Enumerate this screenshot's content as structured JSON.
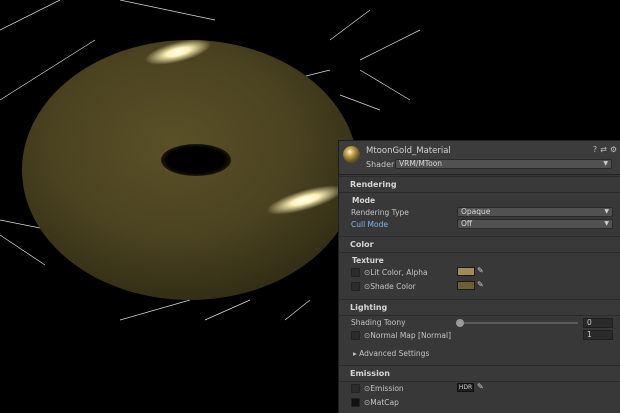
{
  "material": {
    "name": "MtoonGold_Material",
    "shader_label": "Shader",
    "shader_value": "VRM/MToon",
    "header_icons": [
      "help-icon",
      "preset-icon",
      "settings-icon"
    ]
  },
  "sections": {
    "rendering": {
      "title": "Rendering",
      "mode_title": "Mode",
      "rendering_type_label": "Rendering Type",
      "rendering_type_value": "Opaque",
      "cull_mode_label": "Cull Mode",
      "cull_mode_value": "Off"
    },
    "color": {
      "title": "Color",
      "texture_title": "Texture",
      "lit_color_label": "Lit Color, Alpha",
      "lit_color": "#a08b58",
      "shade_color_label": "Shade Color",
      "shade_color": "#6e5f33"
    },
    "lighting": {
      "title": "Lighting",
      "shading_toony_label": "Shading Toony",
      "shading_toony_value": "0",
      "normal_map_label": "Normal Map [Normal]",
      "normal_map_value": "1",
      "advanced_label": "Advanced Settings"
    },
    "emission": {
      "title": "Emission",
      "emission_label": "Emission",
      "hdr_label": "HDR",
      "matcap_label": "MatCap"
    }
  },
  "scene": {
    "torus_color": "#4d4522",
    "highlight_color": "#fff3b8"
  }
}
